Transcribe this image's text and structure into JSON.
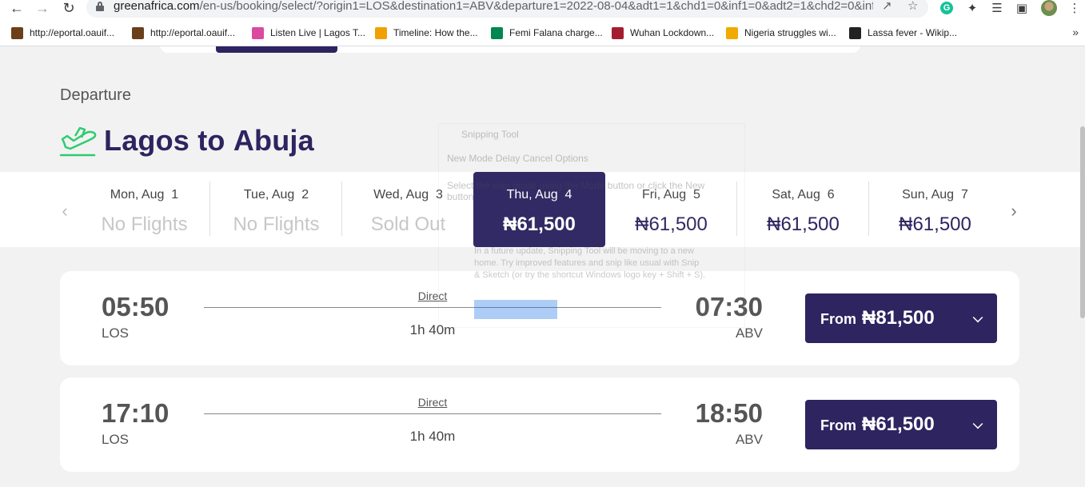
{
  "browser": {
    "url_host": "greenafrica.com",
    "url_path": "/en-us/booking/select/?origin1=LOS&destination1=ABV&departure1=2022-08-04&adt1=1&chd1=0&inf1=0&adt2=1&chd2=0&inf2=...",
    "bookmarks": [
      {
        "label": "http://eportal.oauif...",
        "icon": "oau-crest-icon",
        "color": "#6b3f1a"
      },
      {
        "label": "http://eportal.oauif...",
        "icon": "oau-crest-icon",
        "color": "#6b3f1a"
      },
      {
        "label": "Listen Live | Lagos T...",
        "icon": "radio-icon",
        "color": "#d94aa0"
      },
      {
        "label": "Timeline: How the...",
        "icon": "aljazeera-icon",
        "color": "#f0a100"
      },
      {
        "label": "Femi Falana charge...",
        "icon": "nigeria-flag-icon",
        "color": "#008751"
      },
      {
        "label": "Wuhan Lockdown...",
        "icon": "harvard-icon",
        "color": "#a51c30"
      },
      {
        "label": "Nigeria struggles wi...",
        "icon": "quartz-icon",
        "color": "#f2a900"
      },
      {
        "label": "Lassa fever - Wikip...",
        "icon": "wikipedia-icon",
        "color": "#222222"
      }
    ]
  },
  "page": {
    "section_label": "Departure",
    "route_from": "Lagos to",
    "route_to": "Abuja",
    "accent_color": "#2d2460",
    "green_color": "#2ecc71"
  },
  "dates": [
    {
      "label": "Mon, Aug  1",
      "status": "No Flights",
      "available": false
    },
    {
      "label": "Tue, Aug  2",
      "status": "No Flights",
      "available": false
    },
    {
      "label": "Wed, Aug  3",
      "status": "Sold Out",
      "available": false
    },
    {
      "label": "Thu, Aug  4",
      "status": "₦61,500",
      "available": true,
      "selected": true
    },
    {
      "label": "Fri, Aug  5",
      "status": "₦61,500",
      "available": true
    },
    {
      "label": "Sat, Aug  6",
      "status": "₦61,500",
      "available": true
    },
    {
      "label": "Sun, Aug  7",
      "status": "₦61,500",
      "available": true
    }
  ],
  "flights": [
    {
      "depart_time": "05:50",
      "depart_code": "LOS",
      "arrive_time": "07:30",
      "arrive_code": "ABV",
      "type": "Direct",
      "duration": "1h 40m",
      "fare_prefix": "From",
      "fare": "₦81,500"
    },
    {
      "depart_time": "17:10",
      "depart_code": "LOS",
      "arrive_time": "18:50",
      "arrive_code": "ABV",
      "type": "Direct",
      "duration": "1h 40m",
      "fare_prefix": "From",
      "fare": "₦61,500"
    }
  ],
  "overlay": {
    "title": "Snipping Tool",
    "toolbar": "New    Mode    Delay    Cancel    Options",
    "description": "Select the snip mode using the Mode button or click the New button.",
    "tip": "In a future update, Snipping Tool will be moving to a new home. Try improved features and snip like usual with Snip & Sketch (or try the shortcut Windows logo key + Shift + S)."
  }
}
